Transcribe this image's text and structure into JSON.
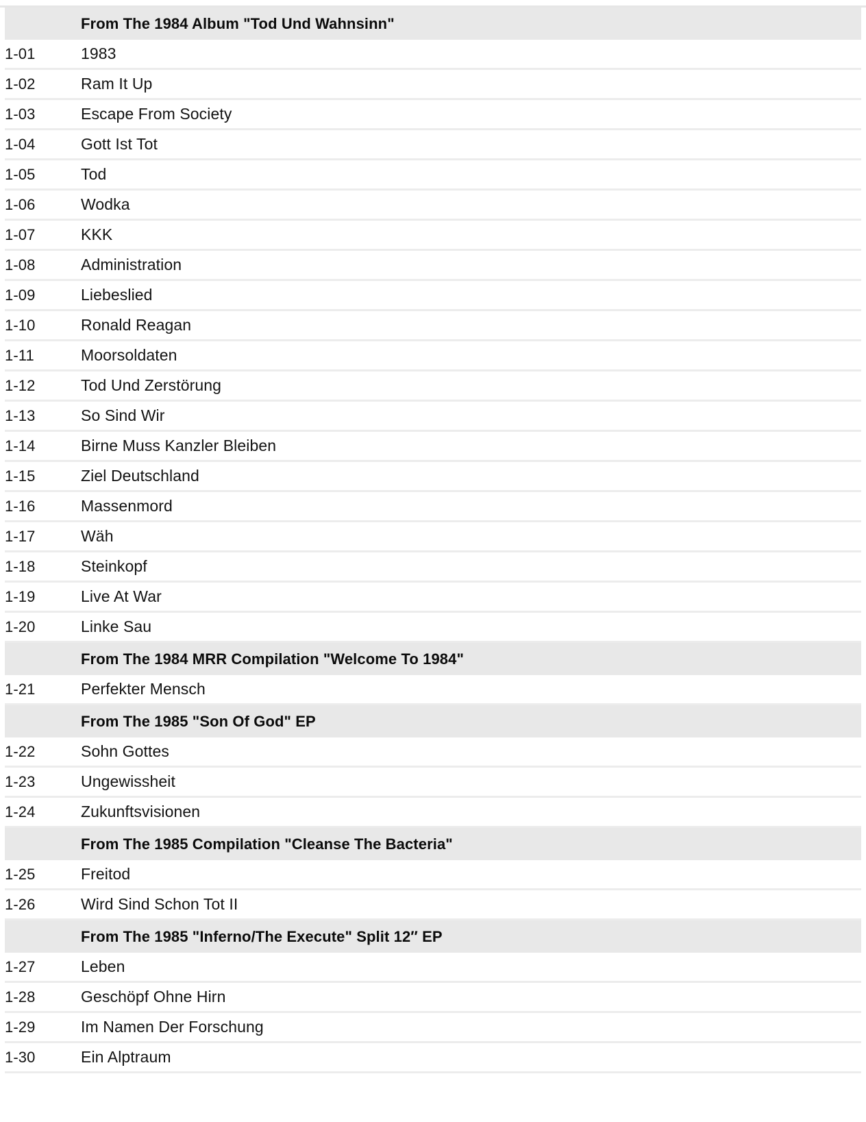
{
  "page": {
    "kind": "release-tracklist",
    "colors": {
      "section_header_background": "#e8e8e8",
      "row_separator": "#ececec",
      "text": "#121212",
      "page_background": "#ffffff"
    }
  },
  "tracklist": {
    "rows": [
      {
        "type": "section",
        "label": "From The 1984 Album \"Tod Und Wahnsinn\""
      },
      {
        "type": "track",
        "position": "1-01",
        "title": "1983"
      },
      {
        "type": "track",
        "position": "1-02",
        "title": "Ram It Up"
      },
      {
        "type": "track",
        "position": "1-03",
        "title": "Escape From Society"
      },
      {
        "type": "track",
        "position": "1-04",
        "title": "Gott Ist Tot"
      },
      {
        "type": "track",
        "position": "1-05",
        "title": "Tod"
      },
      {
        "type": "track",
        "position": "1-06",
        "title": "Wodka"
      },
      {
        "type": "track",
        "position": "1-07",
        "title": "KKK"
      },
      {
        "type": "track",
        "position": "1-08",
        "title": "Administration"
      },
      {
        "type": "track",
        "position": "1-09",
        "title": "Liebeslied"
      },
      {
        "type": "track",
        "position": "1-10",
        "title": "Ronald Reagan"
      },
      {
        "type": "track",
        "position": "1-11",
        "title": "Moorsoldaten"
      },
      {
        "type": "track",
        "position": "1-12",
        "title": "Tod Und Zerstörung"
      },
      {
        "type": "track",
        "position": "1-13",
        "title": "So Sind Wir"
      },
      {
        "type": "track",
        "position": "1-14",
        "title": "Birne Muss Kanzler Bleiben"
      },
      {
        "type": "track",
        "position": "1-15",
        "title": "Ziel Deutschland"
      },
      {
        "type": "track",
        "position": "1-16",
        "title": "Massenmord"
      },
      {
        "type": "track",
        "position": "1-17",
        "title": "Wäh"
      },
      {
        "type": "track",
        "position": "1-18",
        "title": "Steinkopf"
      },
      {
        "type": "track",
        "position": "1-19",
        "title": "Live At War"
      },
      {
        "type": "track",
        "position": "1-20",
        "title": "Linke Sau"
      },
      {
        "type": "section",
        "label": "From The 1984 MRR Compilation \"Welcome To 1984\""
      },
      {
        "type": "track",
        "position": "1-21",
        "title": "Perfekter Mensch"
      },
      {
        "type": "section",
        "label": "From The 1985 \"Son Of God\" EP"
      },
      {
        "type": "track",
        "position": "1-22",
        "title": "Sohn Gottes"
      },
      {
        "type": "track",
        "position": "1-23",
        "title": "Ungewissheit"
      },
      {
        "type": "track",
        "position": "1-24",
        "title": "Zukunftsvisionen"
      },
      {
        "type": "section",
        "label": "From The 1985 Compilation \"Cleanse The Bacteria\""
      },
      {
        "type": "track",
        "position": "1-25",
        "title": "Freitod"
      },
      {
        "type": "track",
        "position": "1-26",
        "title": "Wird Sind Schon Tot II"
      },
      {
        "type": "section",
        "label": "From The 1985 \"Inferno/The Execute\" Split 12″ EP"
      },
      {
        "type": "track",
        "position": "1-27",
        "title": "Leben"
      },
      {
        "type": "track",
        "position": "1-28",
        "title": "Geschöpf Ohne Hirn"
      },
      {
        "type": "track",
        "position": "1-29",
        "title": "Im Namen Der Forschung"
      },
      {
        "type": "track",
        "position": "1-30",
        "title": "Ein Alptraum"
      }
    ]
  }
}
